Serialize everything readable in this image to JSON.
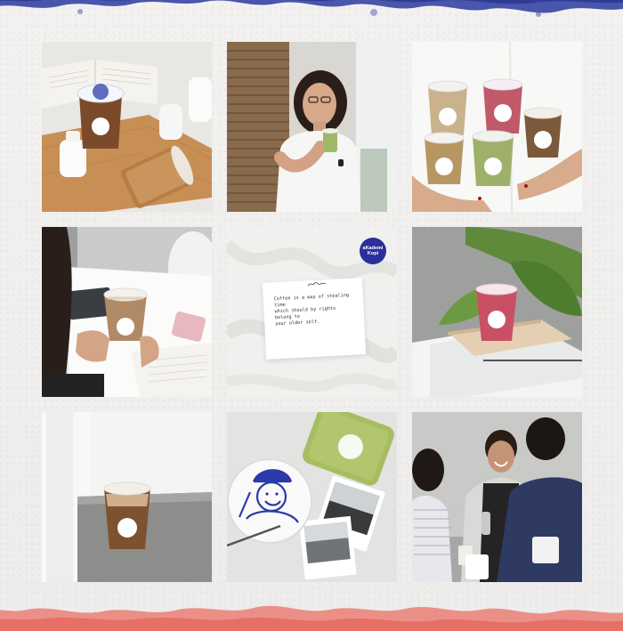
{
  "brand": {
    "cup_label_line1": "aKademi",
    "cup_label_line2": "Kopi",
    "badge_color": "#2a2f9e"
  },
  "quote_card": {
    "line1": "Coffee is a way of stealing time",
    "line2": "which should by rights belong to",
    "line3": "your older self."
  },
  "colors": {
    "top_brush": "#2c3aa0",
    "bottom_brush": "#ea7065",
    "paper": "#f1f0ee"
  },
  "tiles": [
    {
      "id": "tile-1",
      "subject": "iced coffee cups on wooden board"
    },
    {
      "id": "tile-2",
      "subject": "woman sipping matcha drink"
    },
    {
      "id": "tile-3",
      "subject": "hands holding five drink cups"
    },
    {
      "id": "tile-4",
      "subject": "hands holding iced latte at desk"
    },
    {
      "id": "tile-5",
      "subject": "quote card on white fabric"
    },
    {
      "id": "tile-6",
      "subject": "pink drink on stacked books"
    },
    {
      "id": "tile-7",
      "subject": "iced coffee on grey table"
    },
    {
      "id": "tile-8",
      "subject": "matcha cup, cartoon lid and instant photos"
    },
    {
      "id": "tile-9",
      "subject": "barista team smiling"
    }
  ]
}
